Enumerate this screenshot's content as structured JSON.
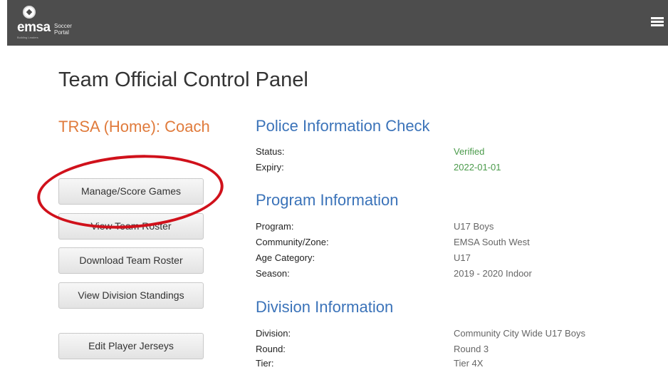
{
  "header": {
    "logo_main": "emsa",
    "logo_sub_line1": "Soccer",
    "logo_sub_line2": "Portal",
    "logo_tagline": "Building Leaders"
  },
  "page_title": "Team Official Control Panel",
  "team_heading": "TRSA (Home): Coach",
  "buttons": {
    "manage_score_games": "Manage/Score Games",
    "view_team_roster": "View Team Roster",
    "download_team_roster": "Download Team Roster",
    "view_division_standings": "View Division Standings",
    "edit_player_jerseys": "Edit Player Jerseys"
  },
  "police_check": {
    "title": "Police Information Check",
    "status_label": "Status:",
    "status_value": "Verified",
    "expiry_label": "Expiry:",
    "expiry_value": "2022-01-01"
  },
  "program_info": {
    "title": "Program Information",
    "program_label": "Program:",
    "program_value": "U17 Boys",
    "community_label": "Community/Zone:",
    "community_value": "EMSA South West",
    "age_label": "Age Category:",
    "age_value": "U17",
    "season_label": "Season:",
    "season_value": "2019 - 2020 Indoor"
  },
  "division_info": {
    "title": "Division Information",
    "division_label": "Division:",
    "division_value": "Community City Wide U17 Boys",
    "round_label": "Round:",
    "round_value": "Round 3",
    "tier_label": "Tier:",
    "tier_value": "Tier 4X"
  },
  "colors": {
    "header_bg": "#4d4d4d",
    "accent_orange": "#e07b3c",
    "section_blue": "#3b73b9",
    "verified_green": "#4a9a4a",
    "annotation_red": "#d0111b"
  }
}
